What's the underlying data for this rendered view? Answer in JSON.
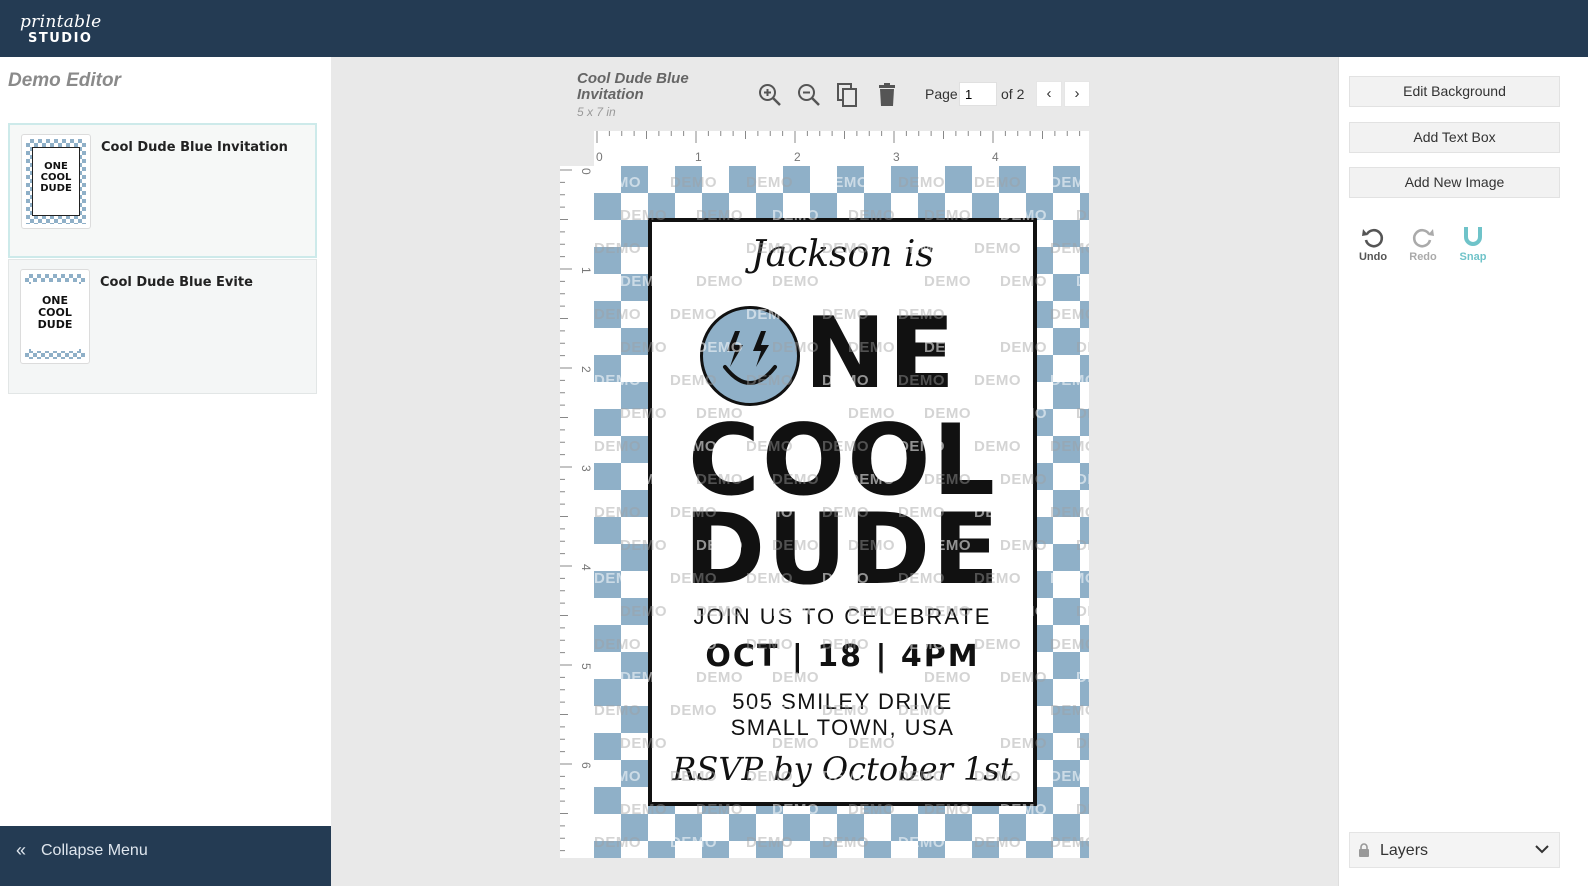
{
  "app": {
    "logo_script": "printable",
    "logo_studio": "STUDIO"
  },
  "sidebar": {
    "title": "Demo Editor",
    "designs": [
      {
        "name": "Cool Dude Blue Invitation"
      },
      {
        "name": "Cool Dude Blue Evite"
      }
    ],
    "collapse_label": "Collapse Menu"
  },
  "document": {
    "title_line1": "Cool Dude Blue",
    "title_line2": "Invitation",
    "size": "5 x 7 in"
  },
  "toolbar": {
    "zoom_in_icon": "zoom-in-icon",
    "zoom_out_icon": "zoom-out-icon",
    "duplicate_icon": "copy-icon",
    "delete_icon": "trash-icon",
    "page_label": "Page",
    "page_value": "1",
    "page_of": "of 2",
    "prev_glyph": "‹",
    "next_glyph": "›"
  },
  "rulers": {
    "horizontal": [
      "0",
      "1",
      "2",
      "3",
      "4"
    ],
    "vertical": [
      "0",
      "1",
      "2",
      "3",
      "4",
      "5",
      "6"
    ]
  },
  "invitation": {
    "name_line": "Jackson is",
    "one_rest": "NE",
    "cool": "COOL",
    "dude": "DUDE",
    "join": "JOIN US TO CELEBRATE",
    "date_line": "OCT | 18 | 4PM",
    "address1": "505 SMILEY DRIVE",
    "address2": "SMALL TOWN, USA",
    "rsvp": "RSVP by October 1st",
    "watermark": "DEMO",
    "accent_color": "#8fb0c8"
  },
  "thumbs": {
    "line1": "ONE",
    "line2": "COOL",
    "line3": "DUDE"
  },
  "right_panel": {
    "edit_background": "Edit Background",
    "add_text_box": "Add Text Box",
    "add_new_image": "Add New Image",
    "undo": "Undo",
    "redo": "Redo",
    "snap": "Snap",
    "layers": "Layers"
  },
  "colors": {
    "topbar": "#243b53",
    "snap_accent": "#6fc3c9"
  }
}
